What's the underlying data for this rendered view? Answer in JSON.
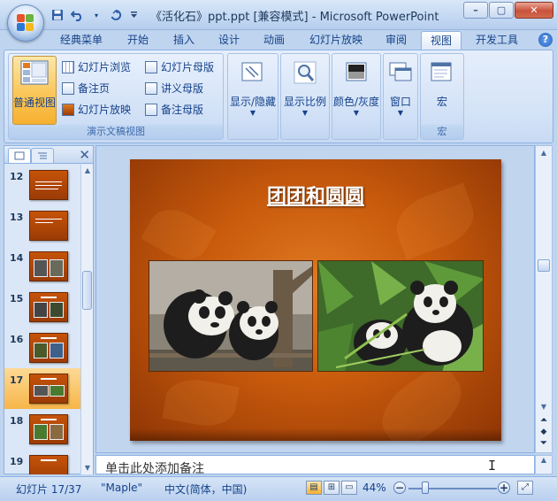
{
  "window": {
    "title": "《活化石》ppt.ppt [兼容模式] - Microsoft PowerPoint",
    "controls": {
      "minimize": "–",
      "maximize": "▢",
      "close": "✕"
    }
  },
  "quick_access": {
    "items": [
      "save-icon",
      "undo-icon",
      "redo-icon",
      "customize-icon"
    ]
  },
  "tabs": [
    {
      "label": "经典菜单"
    },
    {
      "label": "开始"
    },
    {
      "label": "插入"
    },
    {
      "label": "设计"
    },
    {
      "label": "动画"
    },
    {
      "label": "幻灯片放映"
    },
    {
      "label": "审阅"
    },
    {
      "label": "视图",
      "active": true
    },
    {
      "label": "开发工具"
    }
  ],
  "help": "?",
  "ribbon": {
    "presentation_views": {
      "label": "演示文稿视图",
      "normal": "普通视图",
      "slide_sorter": "幻灯片浏览",
      "notes_page": "备注页",
      "slide_show": "幻灯片放映",
      "slide_master": "幻灯片母版",
      "handout_master": "讲义母版",
      "notes_master": "备注母版"
    },
    "show_hide": "显示/隐藏",
    "zoom": "显示比例",
    "color": "颜色/灰度",
    "window": "窗口",
    "macros": {
      "button": "宏",
      "label": "宏"
    }
  },
  "slide_panel": {
    "tab_slides_icon": "slides-tab-icon",
    "tab_outline_icon": "outline-tab-icon",
    "close": "✕",
    "thumbnails": [
      {
        "num": "12"
      },
      {
        "num": "13"
      },
      {
        "num": "14"
      },
      {
        "num": "15"
      },
      {
        "num": "16"
      },
      {
        "num": "17",
        "selected": true
      },
      {
        "num": "18"
      },
      {
        "num": "19"
      }
    ]
  },
  "slide": {
    "title": "团团和圆圆",
    "images": [
      "panda-pair-photo",
      "panda-eating-bamboo-photo"
    ]
  },
  "notes": {
    "placeholder": "单击此处添加备注"
  },
  "status": {
    "slide_count": "幻灯片 17/37",
    "theme": "\"Maple\"",
    "language": "中文(简体，中国)",
    "zoom": "44%"
  },
  "colors": {
    "accent": "#15428b",
    "slide_bg": "#c85a0c",
    "selected": "#f7b649"
  }
}
